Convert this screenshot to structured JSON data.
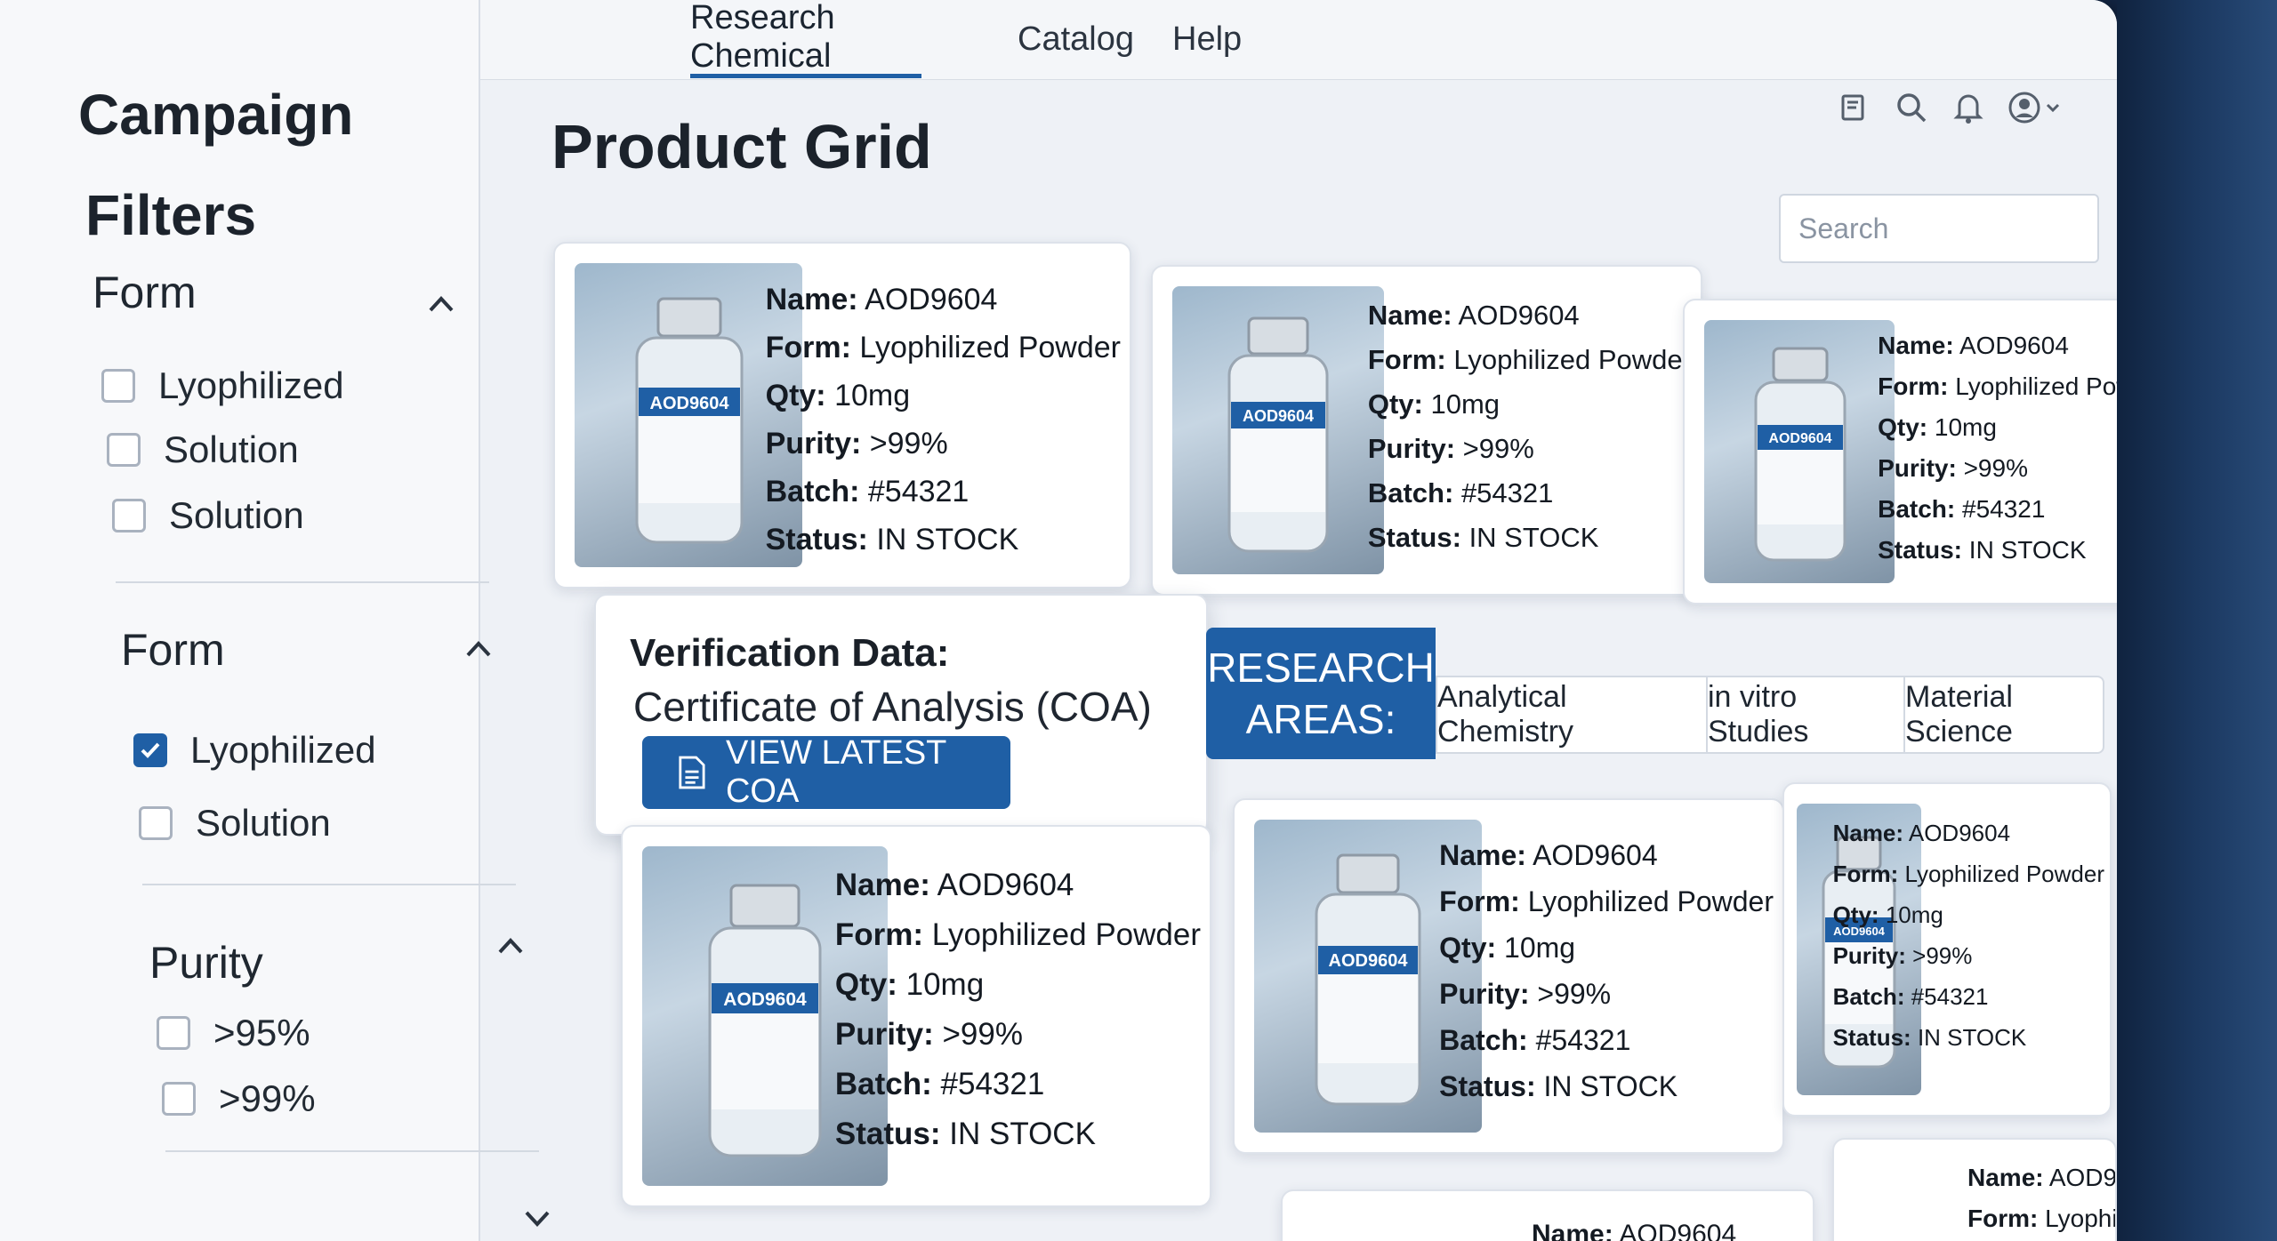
{
  "topnav": {
    "tabs": [
      {
        "label": "Research Chemical",
        "active": true
      },
      {
        "label": "Catalog",
        "active": false
      },
      {
        "label": "Help",
        "active": false
      }
    ],
    "icons": [
      "filter-icon",
      "search-icon",
      "bell-icon",
      "user-icon"
    ]
  },
  "sidebar": {
    "title_line1": "Campaign",
    "title_line2": "Filters",
    "groups": [
      {
        "title": "Form",
        "options": [
          {
            "label": "Lyophilized",
            "checked": false
          },
          {
            "label": "Solution",
            "checked": false
          },
          {
            "label": "Solution",
            "checked": false
          }
        ]
      },
      {
        "title": "Form",
        "options": [
          {
            "label": "Lyophilized",
            "checked": true
          },
          {
            "label": "Solution",
            "checked": false
          }
        ]
      },
      {
        "title": "Purity",
        "options": [
          {
            "label": ">95%",
            "checked": false
          },
          {
            "label": ">99%",
            "checked": false
          }
        ]
      }
    ]
  },
  "main": {
    "page_title": "Product Grid",
    "search": {
      "placeholder": "Search"
    },
    "product": {
      "name_label": "Name:",
      "name": "AOD9604",
      "form_label": "Form:",
      "form": "Lyophilized Powder",
      "qty_label": "Qty:",
      "qty": "10mg",
      "purity_label": "Purity:",
      "purity": ">99%",
      "batch_label": "Batch:",
      "batch": "#54321",
      "status_label": "Status:",
      "status": "IN STOCK",
      "vial_label": "AOD9604"
    },
    "verification": {
      "title": "Verification Data:",
      "subtitle": "Certificate of Analysis (COA)",
      "button": "VIEW LATEST COA"
    },
    "research_areas": {
      "label_line1": "RESEARCH",
      "label_line2": "AREAS:",
      "chips": [
        "Analytical Chemistry",
        "in vitro Studies",
        "Material Science"
      ]
    }
  },
  "colors": {
    "accent": "#1f5fa5",
    "background": "#eef1f6"
  }
}
